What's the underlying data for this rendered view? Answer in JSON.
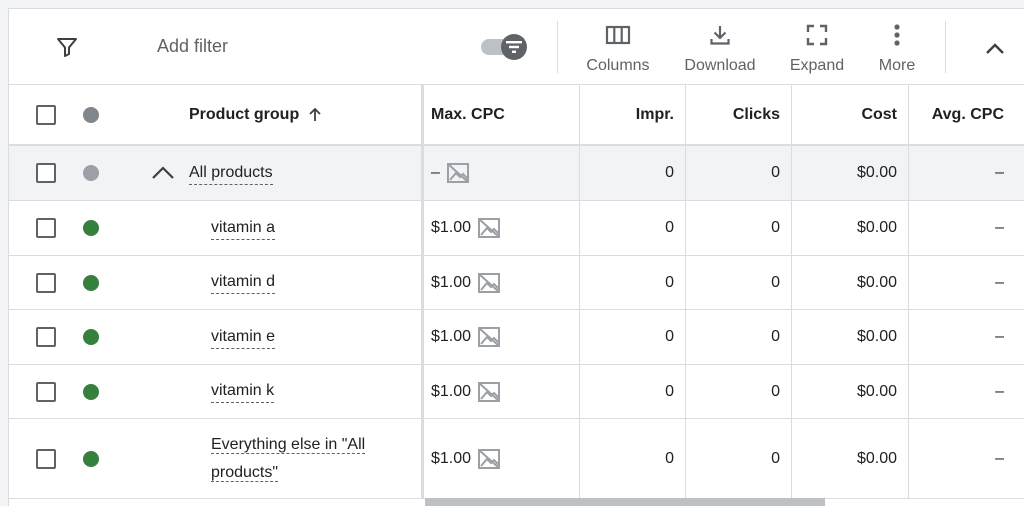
{
  "toolbar": {
    "add_filter": "Add filter",
    "columns": "Columns",
    "download": "Download",
    "expand": "Expand",
    "more": "More"
  },
  "table": {
    "headers": {
      "product_group": "Product group",
      "max_cpc": "Max. CPC",
      "impr": "Impr.",
      "clicks": "Clicks",
      "cost": "Cost",
      "avg_cpc": "Avg. CPC"
    },
    "rows": [
      {
        "name": "All products",
        "max_cpc": "–",
        "impr": "0",
        "clicks": "0",
        "cost": "$0.00",
        "avg_cpc": "–"
      },
      {
        "name": "vitamin a",
        "max_cpc": "$1.00",
        "impr": "0",
        "clicks": "0",
        "cost": "$0.00",
        "avg_cpc": "–"
      },
      {
        "name": "vitamin d",
        "max_cpc": "$1.00",
        "impr": "0",
        "clicks": "0",
        "cost": "$0.00",
        "avg_cpc": "–"
      },
      {
        "name": "vitamin e",
        "max_cpc": "$1.00",
        "impr": "0",
        "clicks": "0",
        "cost": "$0.00",
        "avg_cpc": "–"
      },
      {
        "name": "vitamin k",
        "max_cpc": "$1.00",
        "impr": "0",
        "clicks": "0",
        "cost": "$0.00",
        "avg_cpc": "–"
      },
      {
        "name": "Everything else in \"All products\"",
        "max_cpc": "$1.00",
        "impr": "0",
        "clicks": "0",
        "cost": "$0.00",
        "avg_cpc": "–"
      }
    ]
  },
  "colors": {
    "enabled_status": "#34803c",
    "disabled_status": "#9aa0a6"
  }
}
